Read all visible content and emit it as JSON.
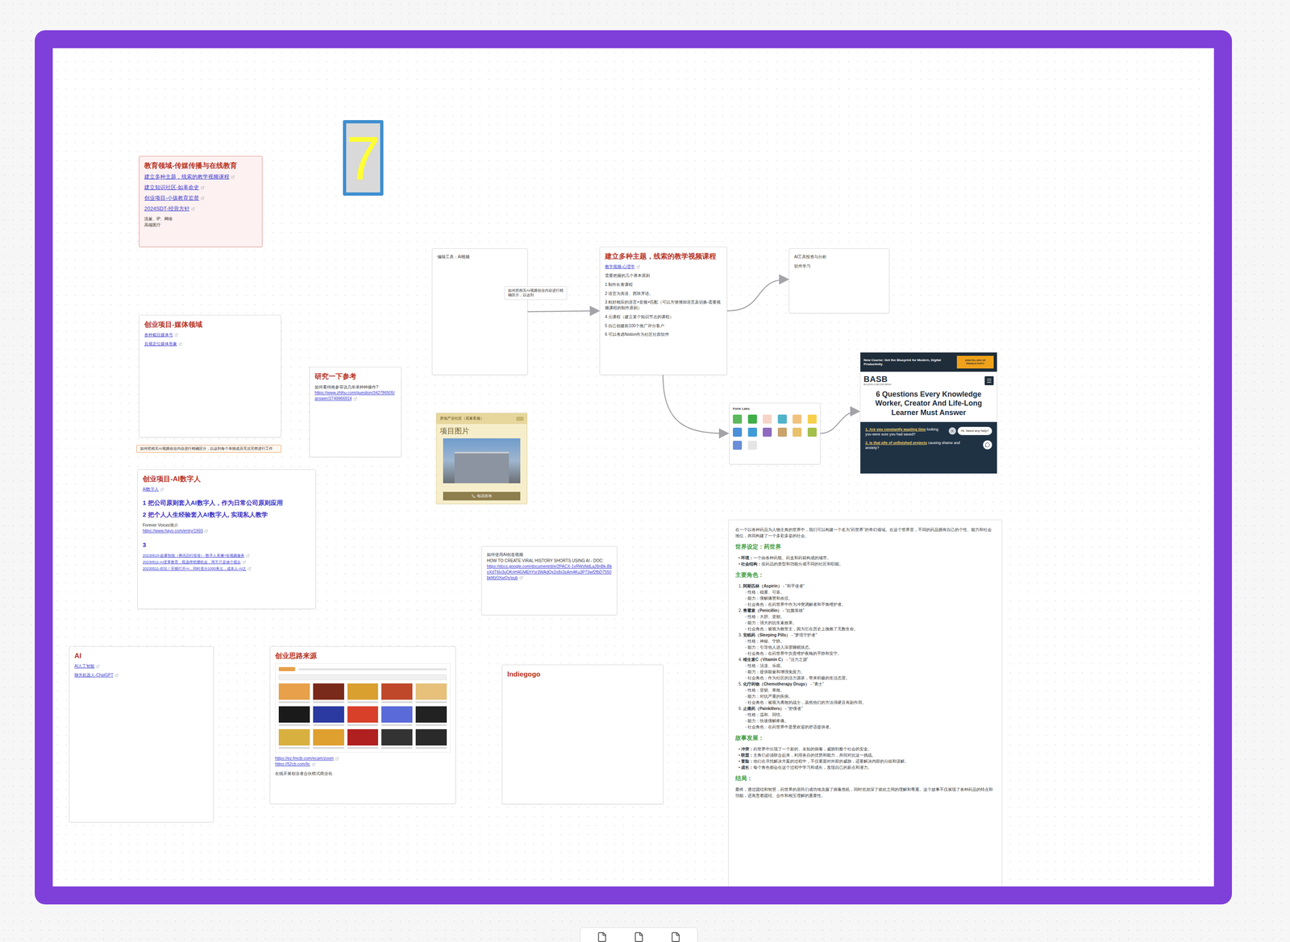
{
  "sticky": {
    "text": "7"
  },
  "education": {
    "title": "教育领域-传媒传播与在线教育",
    "links": [
      "建立多种主题，线索的教学视频课程",
      "建立知识社区-如革命史",
      "创业项目-小孩教育监督",
      "2024SDT-经营方针"
    ],
    "notes": [
      "流量、IP、网络",
      "高端医疗"
    ]
  },
  "media": {
    "title": "创业项目-媒体领域",
    "links": [
      "各种截目媒体号",
      "且规定位媒体形象"
    ]
  },
  "media_note": {
    "text": "如何把相关AI视频创业内容进行精确区分，以达到每个单独成员无法完整进行工作"
  },
  "research": {
    "title": "研究一下参考",
    "text": "如何看待推参哥说几年来种种操作?",
    "link": "https://www.zhihu.com/question/342786505/answer/2749966914"
  },
  "editing_tool": {
    "title": "编辑工具：AI视频"
  },
  "edge_label": {
    "text": "如何把相关AI视频创业内容进行精确区分，以达到"
  },
  "course": {
    "title": "建立多种主题，线索的教学视频课程",
    "link": "教学视频-心理学",
    "lines": [
      "需要把握的几个基本原则",
      "1 制作长青课程",
      "2 语言为英语、西班牙语。",
      "3 精好相应的语言+音频+匹配（可以方便增加语言及切换-需要视频课程的制作原则）",
      "4 元课程（建立某个知识节点的课程）",
      "5 自己创建前100个推广评分客户",
      "6 可以考虑Notion作为社区社群软件"
    ]
  },
  "ai_tools": {
    "lines": [
      "AI工具投资与分析",
      "软件学习"
    ]
  },
  "forte": {
    "brand": "Forte Labs",
    "tiles": [
      {
        "color": "#5cb85c"
      },
      {
        "color": "#3fae49"
      },
      {
        "color": "#f4d5c8"
      },
      {
        "color": "#4fb3c9"
      },
      {
        "color": "#f1c27d"
      },
      {
        "color": "#f6d04d"
      },
      {
        "color": "#4a90d9"
      },
      {
        "color": "#3f9bd6"
      },
      {
        "color": "#8e6bbf"
      },
      {
        "color": "#c9a36b"
      },
      {
        "color": "#e8c16a"
      },
      {
        "color": "#a2c04a"
      },
      {
        "color": "#6a8fd8"
      },
      {
        "color": "#e5e5e5"
      }
    ]
  },
  "basb": {
    "banner": "New Course: Get the Blueprint for Modern, Digital Productivity",
    "cta": "JOIN PILLARS OF PRODUCTIVITY",
    "logo": "BASB",
    "logo_sub": "BUILDING A SECOND BRAIN",
    "title": "6 Questions Every Knowledge Worker, Creator And Life-Long Learner Must Answer",
    "questions": [
      {
        "link": "1. Are you constantly wasting time",
        "text": "looking",
        "text2": "you were sure you had saved?"
      },
      {
        "link": "2. Is that pile of unfinished projects",
        "text": "causing shame and",
        "text2": "anxiety?"
      }
    ],
    "chat": "Hi. Need any help?"
  },
  "property": {
    "header": "房地产业社区（底蓄客服）",
    "title": "项目图片",
    "button": "电话咨询"
  },
  "digital_human": {
    "title": "创业项目-AI数字人",
    "link": "AI数字人",
    "points": [
      "1 把公司原则套入AI数字人，作为日常公司原则应用",
      "2 把个人人生经验套入AI数字人, 实现私人教学"
    ],
    "intro": "Forever Voices简介",
    "intro_link": "https://www.hayo.com/entry/1993",
    "num": "3",
    "news": [
      "20230510-超摹智能（腾讯旧行投资）-数字人直播+短视频服务",
      "20230511-AI变革教育，既选择把握机会，而不只是做个观众",
      "20230511-你玩！安顿打开AI，同时变分1000美元，成本人-AI之"
    ]
  },
  "video_doc": {
    "title": "如何使用AI创造视频",
    "subtitle": "HOW TO CREATE VIRAL HISTORY SHORTS USING AI - DOC:",
    "link": "https://docs.google.com/document/d/e/2PACX-1vRWsNdLaJ9nBk-BkoXdT6lv3uOKnH4GMEhYsr3WAdQx2x8s3sAm4Ku3P73wf2fbD7550bkMz0XwQx/pub"
  },
  "ai": {
    "title": "AI",
    "links": [
      "AI人工智能",
      "聊天机器人-ChatGPT"
    ]
  },
  "ideas": {
    "title": "创业思路来源",
    "thumbnails": [
      {
        "color": "#e8a04a"
      },
      {
        "color": "#7a2a1a"
      },
      {
        "color": "#d9a030"
      },
      {
        "color": "#c0482a"
      },
      {
        "color": "#e7c07a"
      },
      {
        "color": "#1a1a1a"
      },
      {
        "color": "#2a3aa0"
      },
      {
        "color": "#d8402a"
      },
      {
        "color": "#5a6ad8"
      },
      {
        "color": "#222222"
      },
      {
        "color": "#d8b040"
      },
      {
        "color": "#e0a030"
      },
      {
        "color": "#b02020"
      },
      {
        "color": "#333333"
      },
      {
        "color": "#2a2a2a"
      }
    ],
    "links": [
      "https://ez.fmcib.com/ecam/zoom",
      "https://52cb.com/lic"
    ],
    "footer": "在线开展创业者合伙模式商业化"
  },
  "indiegogo": {
    "title": "Indiegogo"
  },
  "story": {
    "intro": "在一个以各种药品为人物主角的世界中，我们可以构建一个名为“药世界”的奇幻领域。在这个世界里，不同的药品拥有自己的个性、能力和社会地位，共同构建了一个多彩多姿的社会。",
    "setting_title": "世界设定：药世界",
    "setting": [
      {
        "label": "环境：",
        "text": "一个由各种药瓶、药盒和药箱构成的城市。"
      },
      {
        "label": "社会结构：",
        "text": "按药品的类型和功能分成不同的社区和职能。"
      }
    ],
    "roles_title": "主要角色：",
    "roles": [
      {
        "num": "1.",
        "name": "阿斯匹林（Aspirin）",
        "epithet": "- “和平使者”",
        "traits": [
          "性格：稳重、可靠。",
          "能力：缓解痛苦和炎症。",
          "社会角色：在药世界中作为冲突调解者和平衡维护者。"
        ]
      },
      {
        "num": "2.",
        "name": "青霉素（Penicillin）",
        "epithet": "- “抗菌英雄”",
        "traits": [
          "性格：大胆、坚韧。",
          "能力：强大的抗生素效果。",
          "社会角色：被视为救世主，因为它在历史上挽救了无数生命。"
        ]
      },
      {
        "num": "3.",
        "name": "安眠药（Sleeping Pills）",
        "epithet": "- “梦境守护者”",
        "traits": [
          "性格：神秘、宁静。",
          "能力：引导他人进入深度睡眠状态。",
          "社会角色：在药世界中负责维护夜晚的平静和安宁。"
        ]
      },
      {
        "num": "4.",
        "name": "维生素C（Vitamin C）",
        "epithet": "- “活力之源”",
        "traits": [
          "性格：活泼、乐观。",
          "能力：提供能量和增强免疫力。",
          "社会角色：作为社区的活力源泉，带来积极的生活态度。"
        ]
      },
      {
        "num": "5.",
        "name": "化疗药物（Chemotherapy Drugs）",
        "epithet": "- “勇士”",
        "traits": [
          "性格：坚韧、果敢。",
          "能力：对抗严重的疾病。",
          "社会角色：被视为勇敢的战士，虽然他们的方法强硬且有副作用。"
        ]
      },
      {
        "num": "6.",
        "name": "止痛药（Painkillers）",
        "epithet": "- “舒缓者”",
        "traits": [
          "性格：温和、同情。",
          "能力：快速缓解疼痛。",
          "社会角色：在药世界中是受欢迎的舒适提供者。"
        ]
      }
    ],
    "plot_title": "故事发展：",
    "plot": [
      {
        "label": "冲突：",
        "text": "药世界中出现了一个新的、未知的病毒，威胁到整个社会的安全。"
      },
      {
        "label": "联盟：",
        "text": "主角们必须联合起来，利用各自的优势和能力，共同对抗这一挑战。"
      },
      {
        "label": "冒险：",
        "text": "他们在寻找解决方案的过程中，不仅要面对外部的威胁，还要解决内部的分歧和误解。"
      },
      {
        "label": "成长：",
        "text": "每个角色都会在这个过程中学习和成长，发现自己的新点和潜力。"
      }
    ],
    "ending_title": "结局：",
    "ending": "最终，通过团结和智慧，药世界的居民们成功地克服了病毒危机，同时也加深了彼此之间的理解和尊重。这个故事不仅展现了各种药品的特点和功能，还寓意着团结、合作和相互理解的重要性。"
  }
}
